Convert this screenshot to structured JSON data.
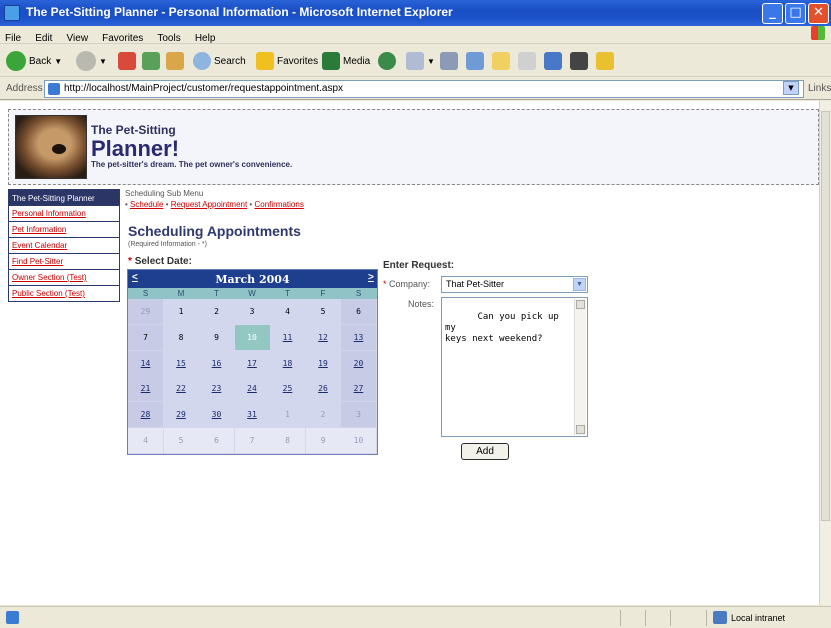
{
  "window": {
    "title": "The Pet-Sitting Planner - Personal Information - Microsoft Internet Explorer"
  },
  "menu": [
    "File",
    "Edit",
    "View",
    "Favorites",
    "Tools",
    "Help"
  ],
  "toolbar": {
    "back": "Back",
    "search": "Search",
    "favorites": "Favorites",
    "media": "Media"
  },
  "address": {
    "label": "Address",
    "url": "http://localhost/MainProject/customer/requestappointment.aspx",
    "links": "Links"
  },
  "header": {
    "top": "The Pet-Sitting",
    "main": "Planner!",
    "tagline": "The pet-sitter's dream. The pet owner's convenience."
  },
  "sidemenu": [
    "The Pet-Sitting Planner",
    "Personal Information",
    "Pet Information",
    "Event Calendar",
    "Find Pet-Sitter",
    "Owner Section (Test)",
    "Public Section (Test)"
  ],
  "submenu": {
    "title": "Scheduling Sub Menu",
    "links": [
      "Schedule",
      "Request Appointment",
      "Confirmations"
    ],
    "bullet": "•"
  },
  "page": {
    "title": "Scheduling Appointments",
    "required": "(Required Information - *)",
    "select_date": "Select Date:",
    "star": "*"
  },
  "calendar": {
    "title": "March 2004",
    "prev": "<",
    "next": ">",
    "dow": [
      "S",
      "M",
      "T",
      "W",
      "T",
      "F",
      "S"
    ],
    "weeks": [
      [
        "29",
        "1",
        "2",
        "3",
        "4",
        "5",
        "6"
      ],
      [
        "7",
        "8",
        "9",
        "10",
        "11",
        "12",
        "13"
      ],
      [
        "14",
        "15",
        "16",
        "17",
        "18",
        "19",
        "20"
      ],
      [
        "21",
        "22",
        "23",
        "24",
        "25",
        "26",
        "27"
      ],
      [
        "28",
        "29",
        "30",
        "31",
        "1",
        "2",
        "3"
      ],
      [
        "4",
        "5",
        "6",
        "7",
        "8",
        "9",
        "10"
      ]
    ],
    "selected": "10"
  },
  "request": {
    "heading": "Enter Request:",
    "company_label": "Company:",
    "company_value": "That Pet-Sitter",
    "notes_label": "Notes:",
    "notes_value": "Can you pick up my\nkeys next weekend?",
    "add_label": "Add"
  },
  "status": {
    "zone": "Local intranet"
  },
  "colors": {
    "titlebar": "#1c52c9",
    "nav_head": "#2b3566",
    "link_red": "#cc0000",
    "calendar_head": "#1e3f8e",
    "today": "#93c7c2"
  }
}
